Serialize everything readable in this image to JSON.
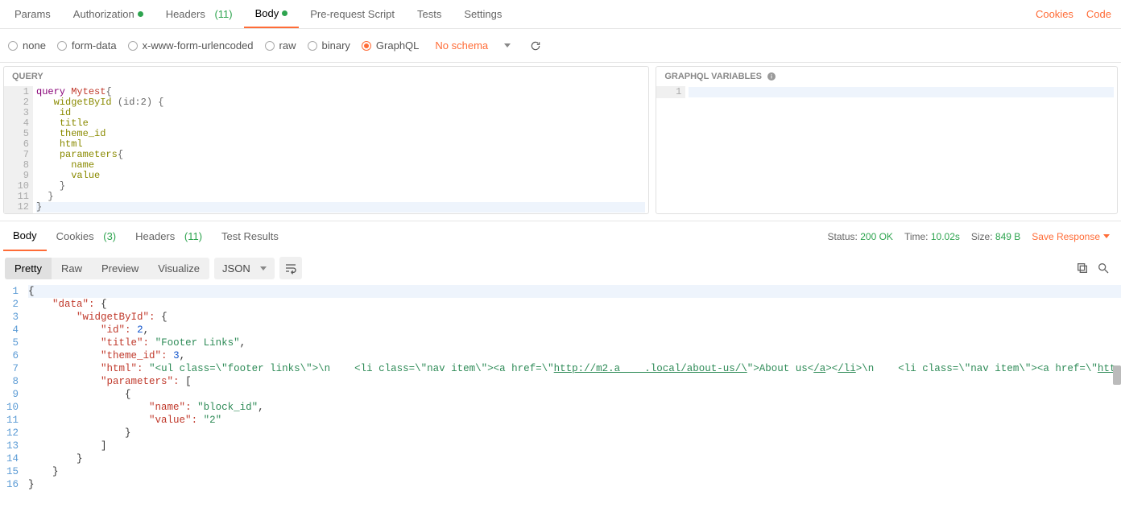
{
  "topTabs": {
    "params": "Params",
    "authorization": "Authorization",
    "headers": "Headers",
    "headersCount": "(11)",
    "body": "Body",
    "preRequest": "Pre-request Script",
    "tests": "Tests",
    "settings": "Settings",
    "cookies": "Cookies",
    "code": "Code"
  },
  "bodyTypes": {
    "none": "none",
    "formData": "form-data",
    "xwww": "x-www-form-urlencoded",
    "raw": "raw",
    "binary": "binary",
    "graphql": "GraphQL",
    "schemaText": "No schema"
  },
  "queryPanel": {
    "title": "QUERY",
    "lines": {
      "1": {
        "kw": "query",
        "name": "Mytest",
        "brace": "{"
      },
      "2": {
        "indent": "   ",
        "call": "widgetById",
        "args": "(id:2)",
        "brace": " {"
      },
      "3": {
        "indent": "    ",
        "field": "id"
      },
      "4": {
        "indent": "    ",
        "field": "title"
      },
      "5": {
        "indent": "    ",
        "field": "theme_id"
      },
      "6": {
        "indent": "    ",
        "field": "html"
      },
      "7": {
        "indent": "    ",
        "field": "parameters",
        "brace": "{"
      },
      "8": {
        "indent": "      ",
        "field": "name"
      },
      "9": {
        "indent": "      ",
        "field": "value"
      },
      "10": {
        "indent": "    ",
        "brace": "}"
      },
      "11": {
        "indent": "  ",
        "brace": "}"
      },
      "12": {
        "brace": "}"
      }
    }
  },
  "varsPanel": {
    "title": "GRAPHQL VARIABLES",
    "line1": "1"
  },
  "responseTabs": {
    "body": "Body",
    "cookies": "Cookies",
    "cookiesCount": "(3)",
    "headers": "Headers",
    "headersCount": "(11)",
    "testResults": "Test Results"
  },
  "meta": {
    "statusLabel": "Status:",
    "statusValue": "200 OK",
    "timeLabel": "Time:",
    "timeValue": "10.02s",
    "sizeLabel": "Size:",
    "sizeValue": "849 B",
    "saveResponse": "Save Response"
  },
  "viewButtons": {
    "pretty": "Pretty",
    "raw": "Raw",
    "preview": "Preview",
    "visualize": "Visualize",
    "json": "JSON"
  },
  "response": {
    "lines": [
      {
        "n": "1",
        "html": "<span class='jpunc'>{</span>"
      },
      {
        "n": "2",
        "html": "    <span class='jkey'>\"data\"</span><span class='jcolon'>:</span> <span class='jpunc'>{</span>"
      },
      {
        "n": "3",
        "html": "        <span class='jkey'>\"widgetById\"</span><span class='jcolon'>:</span> <span class='jpunc'>{</span>"
      },
      {
        "n": "4",
        "html": "            <span class='jkey'>\"id\"</span><span class='jcolon'>:</span> <span class='jnum'>2</span><span class='jpunc'>,</span>"
      },
      {
        "n": "5",
        "html": "            <span class='jkey'>\"title\"</span><span class='jcolon'>:</span> <span class='jstr'>\"Footer Links\"</span><span class='jpunc'>,</span>"
      },
      {
        "n": "6",
        "html": "            <span class='jkey'>\"theme_id\"</span><span class='jcolon'>:</span> <span class='jnum'>3</span><span class='jpunc'>,</span>"
      },
      {
        "n": "7",
        "html": "            <span class='jkey'>\"html\"</span><span class='jcolon'>:</span> <span class='jstr'>\"&lt;ul class=\\\"footer links\\\"&gt;\\n    &lt;li class=\\\"nav item\\\"&gt;&lt;a href=\\\"<span class='ul-link'>http://m2.a    .local/about-us/\\</span>\"&gt;About us&lt;<span class='ul-link'>/a</span>&gt;&lt;<span class='ul-link'>/li</span>&gt;\\n    &lt;li class=\\\"nav item\\\"&gt;&lt;a href=\\\"<span class='ul-link'>http:/</span></span>"
      },
      {
        "n": "8",
        "html": "            <span class='jkey'>\"parameters\"</span><span class='jcolon'>:</span> <span class='jpunc'>[</span>"
      },
      {
        "n": "9",
        "html": "                <span class='jpunc'>{</span>"
      },
      {
        "n": "10",
        "html": "                    <span class='jkey'>\"name\"</span><span class='jcolon'>:</span> <span class='jstr'>\"block_id\"</span><span class='jpunc'>,</span>"
      },
      {
        "n": "11",
        "html": "                    <span class='jkey'>\"value\"</span><span class='jcolon'>:</span> <span class='jstr'>\"2\"</span>"
      },
      {
        "n": "12",
        "html": "                <span class='jpunc'>}</span>"
      },
      {
        "n": "13",
        "html": "            <span class='jpunc'>]</span>"
      },
      {
        "n": "14",
        "html": "        <span class='jpunc'>}</span>"
      },
      {
        "n": "15",
        "html": "    <span class='jpunc'>}</span>"
      },
      {
        "n": "16",
        "html": "<span class='jpunc'>}</span>"
      }
    ]
  }
}
